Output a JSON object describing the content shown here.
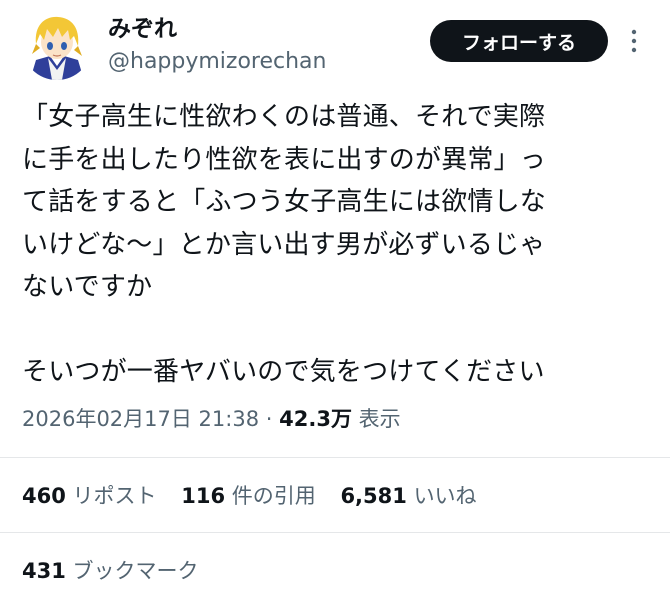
{
  "author": {
    "display_name": "みぞれ",
    "handle": "@happymizorechan",
    "avatar_icon": "anime-character-avatar-icon"
  },
  "header": {
    "follow_label": "フォローする",
    "more_icon": "more-vertical-icon"
  },
  "tweet": {
    "text": "「女子高生に性欲わくのは普通、それで実際\nに手を出したり性欲を表に出すのが異常」っ\nて話をすると「ふつう女子高生には欲情しな\nいけどな〜」とか言い出す男が必ずいるじゃ\nないですか\n\nそいつが一番ヤバいので気をつけてください"
  },
  "meta": {
    "datetime": "2026年02月17日 21:38",
    "separator": "·",
    "views_count": "42.3万",
    "views_label": "表示"
  },
  "stats": {
    "reposts_count": "460",
    "reposts_label": "リポスト",
    "quotes_count": "116",
    "quotes_label": "件の引用",
    "likes_count": "6,581",
    "likes_label": "いいね",
    "bookmarks_count": "431",
    "bookmarks_label": "ブックマーク"
  },
  "colors": {
    "text_primary": "#0f1419",
    "text_secondary": "#536471",
    "divider": "#e5e7e9",
    "follow_button_bg": "#0f1419"
  }
}
